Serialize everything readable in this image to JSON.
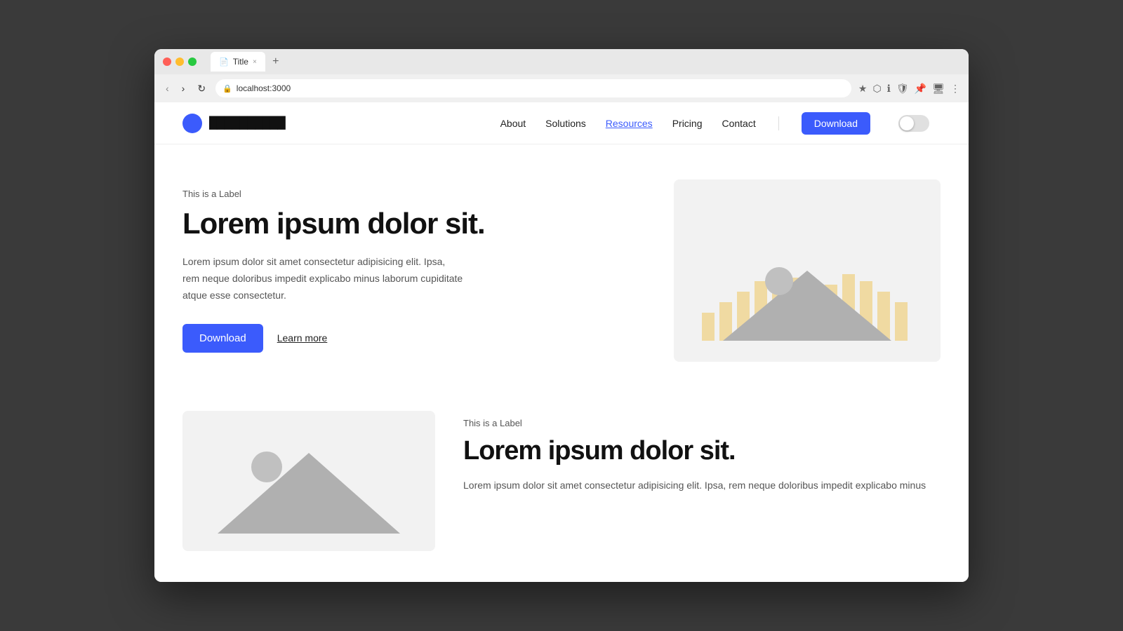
{
  "browser": {
    "tab_title": "Title",
    "url": "localhost:3000",
    "tab_close": "×",
    "tab_new": "+",
    "nav": {
      "back": "‹",
      "forward": "›",
      "reload": "↻"
    },
    "icons": [
      "★",
      "≡",
      "ℹ",
      "🛡",
      "📌",
      "🖥",
      "⋮"
    ]
  },
  "site": {
    "logo_text": "██████████",
    "nav": {
      "about": "About",
      "solutions": "Solutions",
      "resources": "Resources",
      "pricing": "Pricing",
      "contact": "Contact",
      "download": "Download"
    }
  },
  "hero": {
    "label": "This is a Label",
    "title": "Lorem ipsum dolor sit.",
    "description": "Lorem ipsum dolor sit amet consectetur adipisicing elit. Ipsa, rem neque doloribus impedit explicabo minus laborum cupiditate atque esse consectetur.",
    "btn_download": "Download",
    "btn_learn": "Learn more"
  },
  "second": {
    "label": "This is a Label",
    "title": "Lorem ipsum dolor sit.",
    "description": "Lorem ipsum dolor sit amet consectetur adipisicing elit. Ipsa, rem neque doloribus impedit explicabo minus"
  }
}
